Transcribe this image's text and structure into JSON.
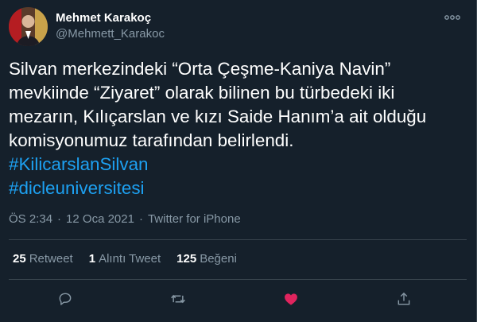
{
  "author": {
    "display_name": "Mehmet Karakoç",
    "handle": "@Mehmett_Karakoc"
  },
  "tweet": {
    "text": "Silvan merkezindeki “Orta Çeşme-Kaniya Navin” mevkiinde “Ziyaret” olarak bilinen bu türbedeki iki mezarın, Kılıçarslan ve kızı Saide Hanım’a ait olduğu komisyonumuz tarafından belirlendi.",
    "hashtags": [
      "#KilicarslanSilvan",
      "#dicleuniversitesi"
    ]
  },
  "meta": {
    "time": "ÖS 2:34",
    "separator": "·",
    "date": "12 Oca 2021",
    "source": "Twitter for iPhone"
  },
  "stats": {
    "retweets_count": "25",
    "retweets_label": "Retweet",
    "quotes_count": "1",
    "quotes_label": "Alıntı Tweet",
    "likes_count": "125",
    "likes_label": "Beğeni"
  },
  "icons": {
    "more": "more-horizontal-icon",
    "reply": "reply-icon",
    "retweet": "retweet-icon",
    "like": "heart-icon",
    "share": "share-icon"
  },
  "colors": {
    "background": "#15202b",
    "secondary_text": "#8899a6",
    "link": "#1da1f2",
    "like_active": "#e0245e",
    "divider": "#38444d"
  }
}
